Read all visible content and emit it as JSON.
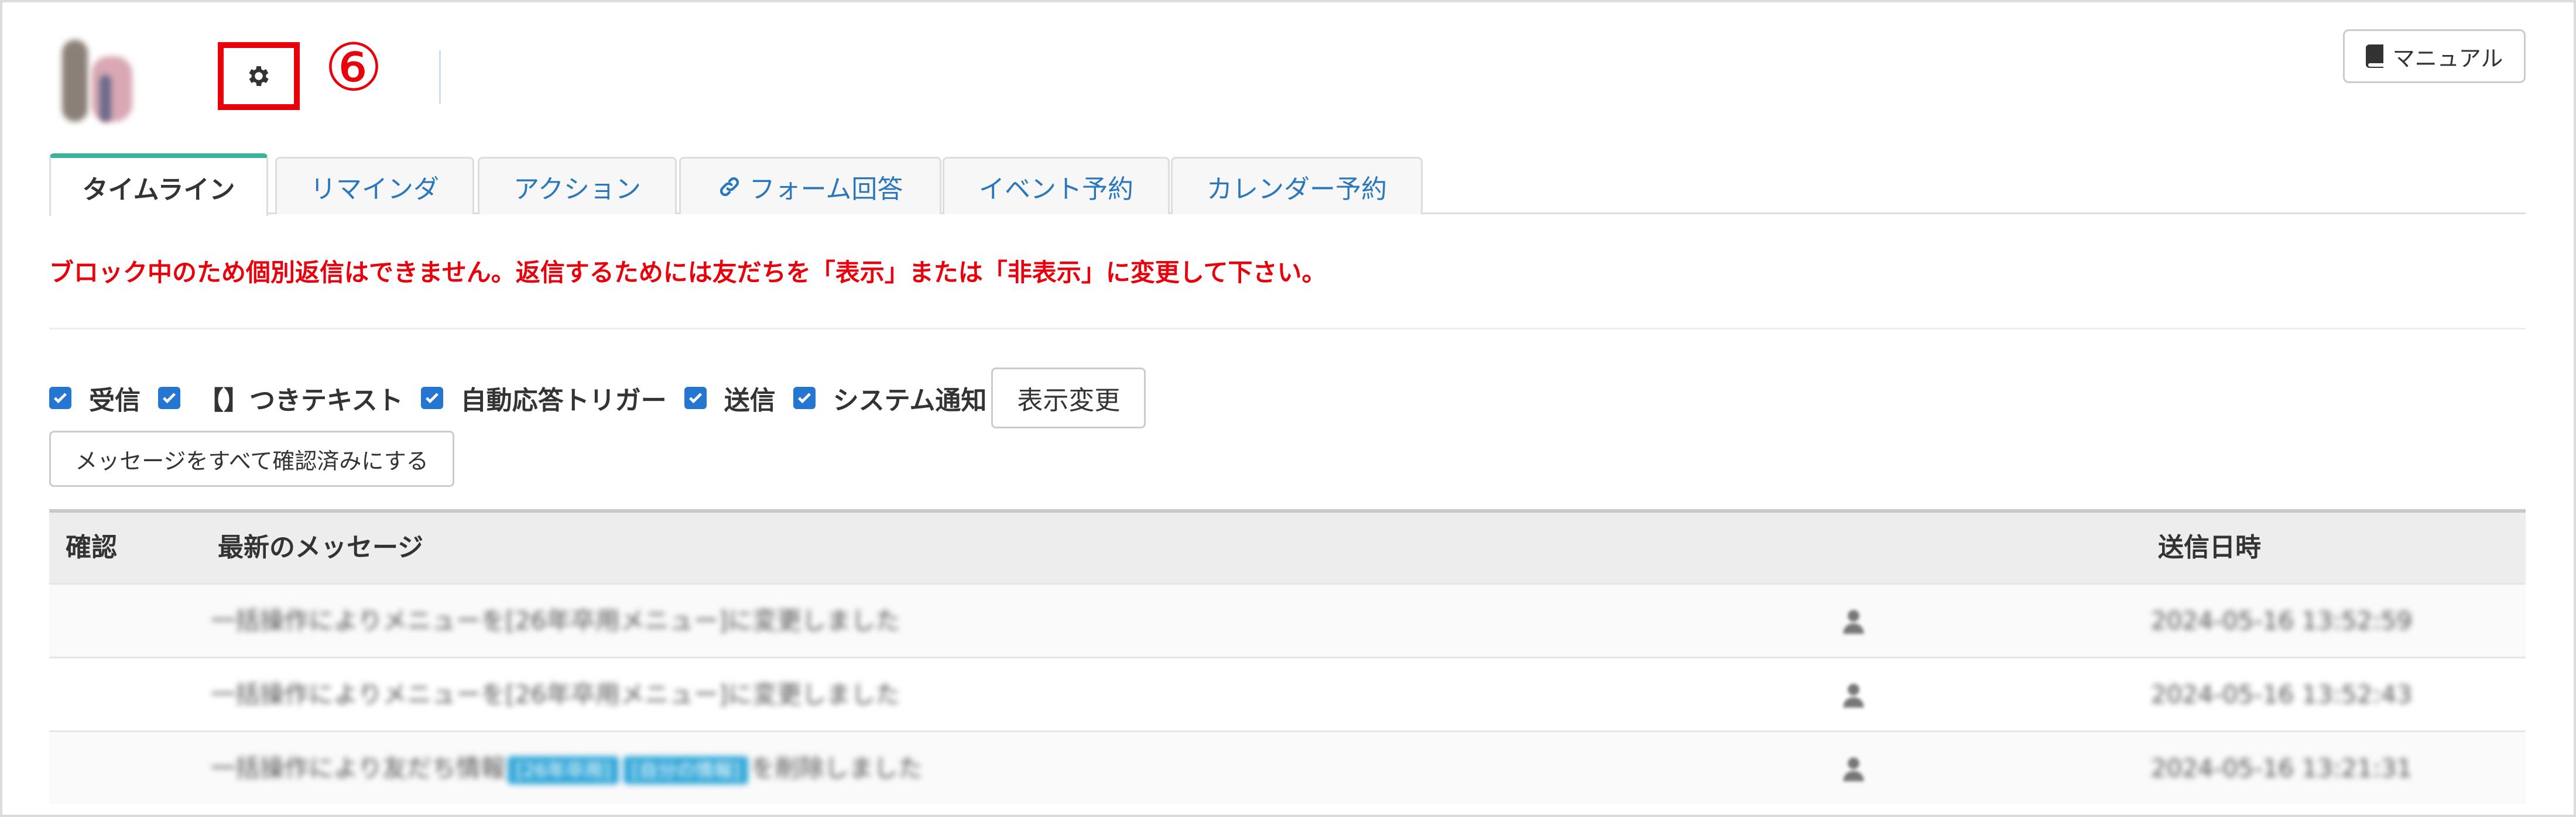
{
  "header": {
    "step_number": "⑥",
    "manual_label": "マニュアル"
  },
  "tabs": [
    {
      "label": "タイムライン",
      "active": true
    },
    {
      "label": "リマインダ",
      "active": false
    },
    {
      "label": "アクション",
      "active": false
    },
    {
      "label": "フォーム回答",
      "active": false,
      "icon": "link-icon"
    },
    {
      "label": "イベント予約",
      "active": false
    },
    {
      "label": "カレンダー予約",
      "active": false
    }
  ],
  "block_message": "ブロック中のため個別返信はできません。返信するためには友だちを「表示」または「非表示」に変更して下さい。",
  "filters": [
    {
      "label": "受信",
      "checked": true
    },
    {
      "label": "【】つきテキスト",
      "checked": true
    },
    {
      "label": "自動応答トリガー",
      "checked": true
    },
    {
      "label": "送信",
      "checked": true
    },
    {
      "label": "システム通知",
      "checked": true
    }
  ],
  "display_change_label": "表示変更",
  "mark_all_read_label": "メッセージをすべて確認済みにする",
  "table": {
    "headers": {
      "confirm": "確認",
      "latest_message": "最新のメッセージ",
      "sent_at": "送信日時"
    },
    "rows": [
      {
        "message": "一括操作によりメニューを[26年卒用メニュー]に変更しました",
        "date": "2024-05-16 13:52:59"
      },
      {
        "message": "一括操作によりメニューを[26年卒用メニュー]に変更しました",
        "date": "2024-05-16 13:52:43"
      },
      {
        "message_before": "一括操作により友だち情報",
        "tag1": "[26年卒用]",
        "tag2": "[自分の情報]",
        "message_after": "を削除しました",
        "date": "2024-05-16 13:21:31"
      }
    ]
  },
  "colors": {
    "accent_red": "#e8000b",
    "tab_active_border": "#3bb39a",
    "link_blue": "#2a78bb",
    "checkbox_blue": "#2576d3",
    "tag_blue": "#36a9d9"
  }
}
